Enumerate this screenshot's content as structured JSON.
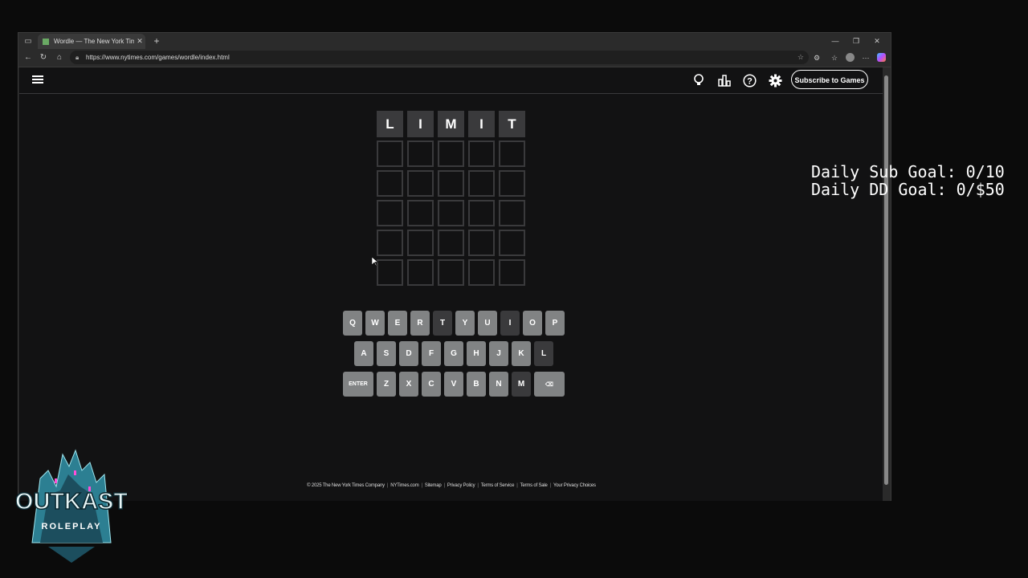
{
  "browser": {
    "tab_title": "Wordle — The New York Times",
    "url": "https://www.nytimes.com/games/wordle/index.html"
  },
  "header": {
    "subscribe_label": "Subscribe to Games"
  },
  "board": {
    "rows": [
      [
        "L",
        "I",
        "M",
        "I",
        "T"
      ],
      [
        "",
        "",
        "",
        "",
        ""
      ],
      [
        "",
        "",
        "",
        "",
        ""
      ],
      [
        "",
        "",
        "",
        "",
        ""
      ],
      [
        "",
        "",
        "",
        "",
        ""
      ],
      [
        "",
        "",
        "",
        "",
        ""
      ]
    ]
  },
  "keyboard": {
    "row1": [
      "Q",
      "W",
      "E",
      "R",
      "T",
      "Y",
      "U",
      "I",
      "O",
      "P"
    ],
    "row2": [
      "A",
      "S",
      "D",
      "F",
      "G",
      "H",
      "J",
      "K",
      "L"
    ],
    "row3": [
      "ENTER",
      "Z",
      "X",
      "C",
      "V",
      "B",
      "N",
      "M",
      "⌫"
    ],
    "absent_keys": [
      "T",
      "I",
      "L",
      "M"
    ]
  },
  "footer": {
    "links": [
      "© 2025 The New York Times Company",
      "NYTimes.com",
      "Sitemap",
      "Privacy Policy",
      "Terms of Service",
      "Terms of Sale",
      "Your Privacy Choices"
    ]
  },
  "overlay": {
    "sub_goal": "Daily Sub Goal: 0/10",
    "dd_goal": "Daily DD Goal: 0/$50",
    "logo_line1": "OUTKAST",
    "logo_line2": "ROLEPLAY"
  }
}
